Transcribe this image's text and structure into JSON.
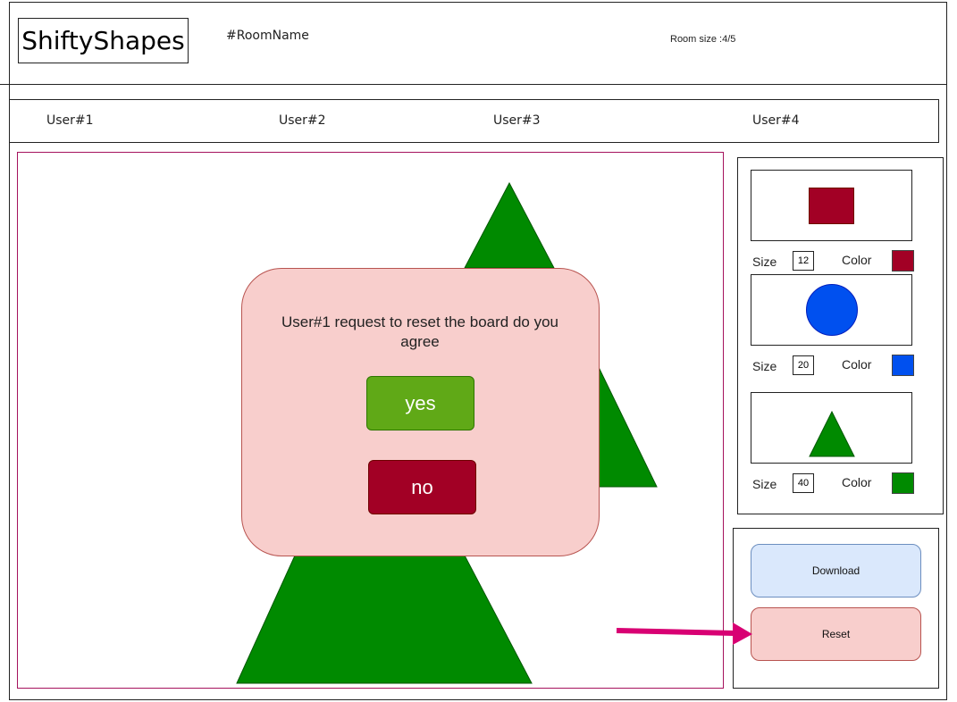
{
  "header": {
    "logo": "ShiftyShapes",
    "room_name": "#RoomName",
    "room_size": "Room size :4/5"
  },
  "users": [
    "User#1",
    "User#2",
    "User#3",
    "User#4"
  ],
  "shapes": [
    {
      "type": "rectangle",
      "size_label": "Size",
      "size": "12",
      "color_label": "Color",
      "color": "#a20025"
    },
    {
      "type": "circle",
      "size_label": "Size",
      "size": "20",
      "color_label": "Color",
      "color": "#0050ef"
    },
    {
      "type": "triangle",
      "size_label": "Size",
      "size": "40",
      "color_label": "Color",
      "color": "#008a00"
    }
  ],
  "actions": {
    "download_label": "Download",
    "reset_label": "Reset"
  },
  "modal": {
    "message": "User#1 request to reset the board do you agree",
    "yes_label": "yes",
    "no_label": "no"
  },
  "colors": {
    "canvas_border": "#a5125d",
    "arrow": "#d80073",
    "shape_green": "#008a00"
  }
}
